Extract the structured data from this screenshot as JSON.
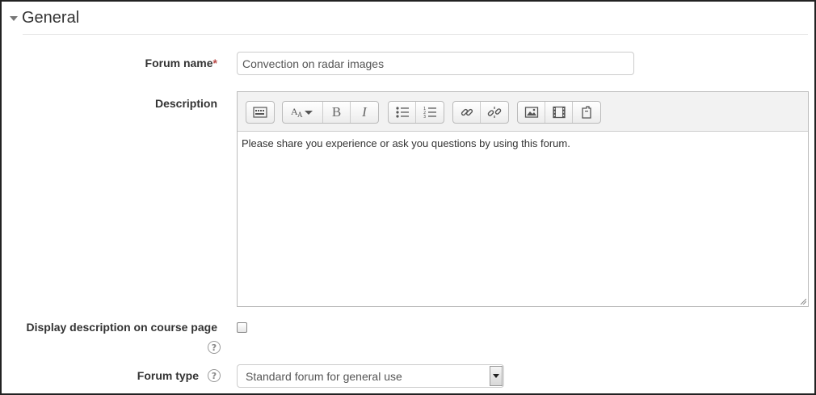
{
  "section": {
    "title": "General"
  },
  "fields": {
    "forum_name": {
      "label": "Forum name",
      "required_marker": "*",
      "value": "Convection on radar images"
    },
    "description": {
      "label": "Description",
      "content": "Please share you experience or ask you questions by using this forum."
    },
    "display_description": {
      "label": "Display description on course page",
      "checked": false
    },
    "forum_type": {
      "label": "Forum type",
      "selected": "Standard forum for general use"
    }
  },
  "editor_toolbar": {
    "groups": [
      [
        "toolbar-toggle-icon"
      ],
      [
        "font-style-icon",
        "bold-icon",
        "italic-icon"
      ],
      [
        "unordered-list-icon",
        "ordered-list-icon"
      ],
      [
        "link-icon",
        "unlink-icon"
      ],
      [
        "image-icon",
        "media-icon",
        "manage-files-icon"
      ]
    ],
    "bold_glyph": "B",
    "italic_glyph": "I"
  },
  "help_icon_glyph": "?",
  "colors": {
    "required": "#b94a48",
    "label": "#333333",
    "border": "#cccccc"
  }
}
